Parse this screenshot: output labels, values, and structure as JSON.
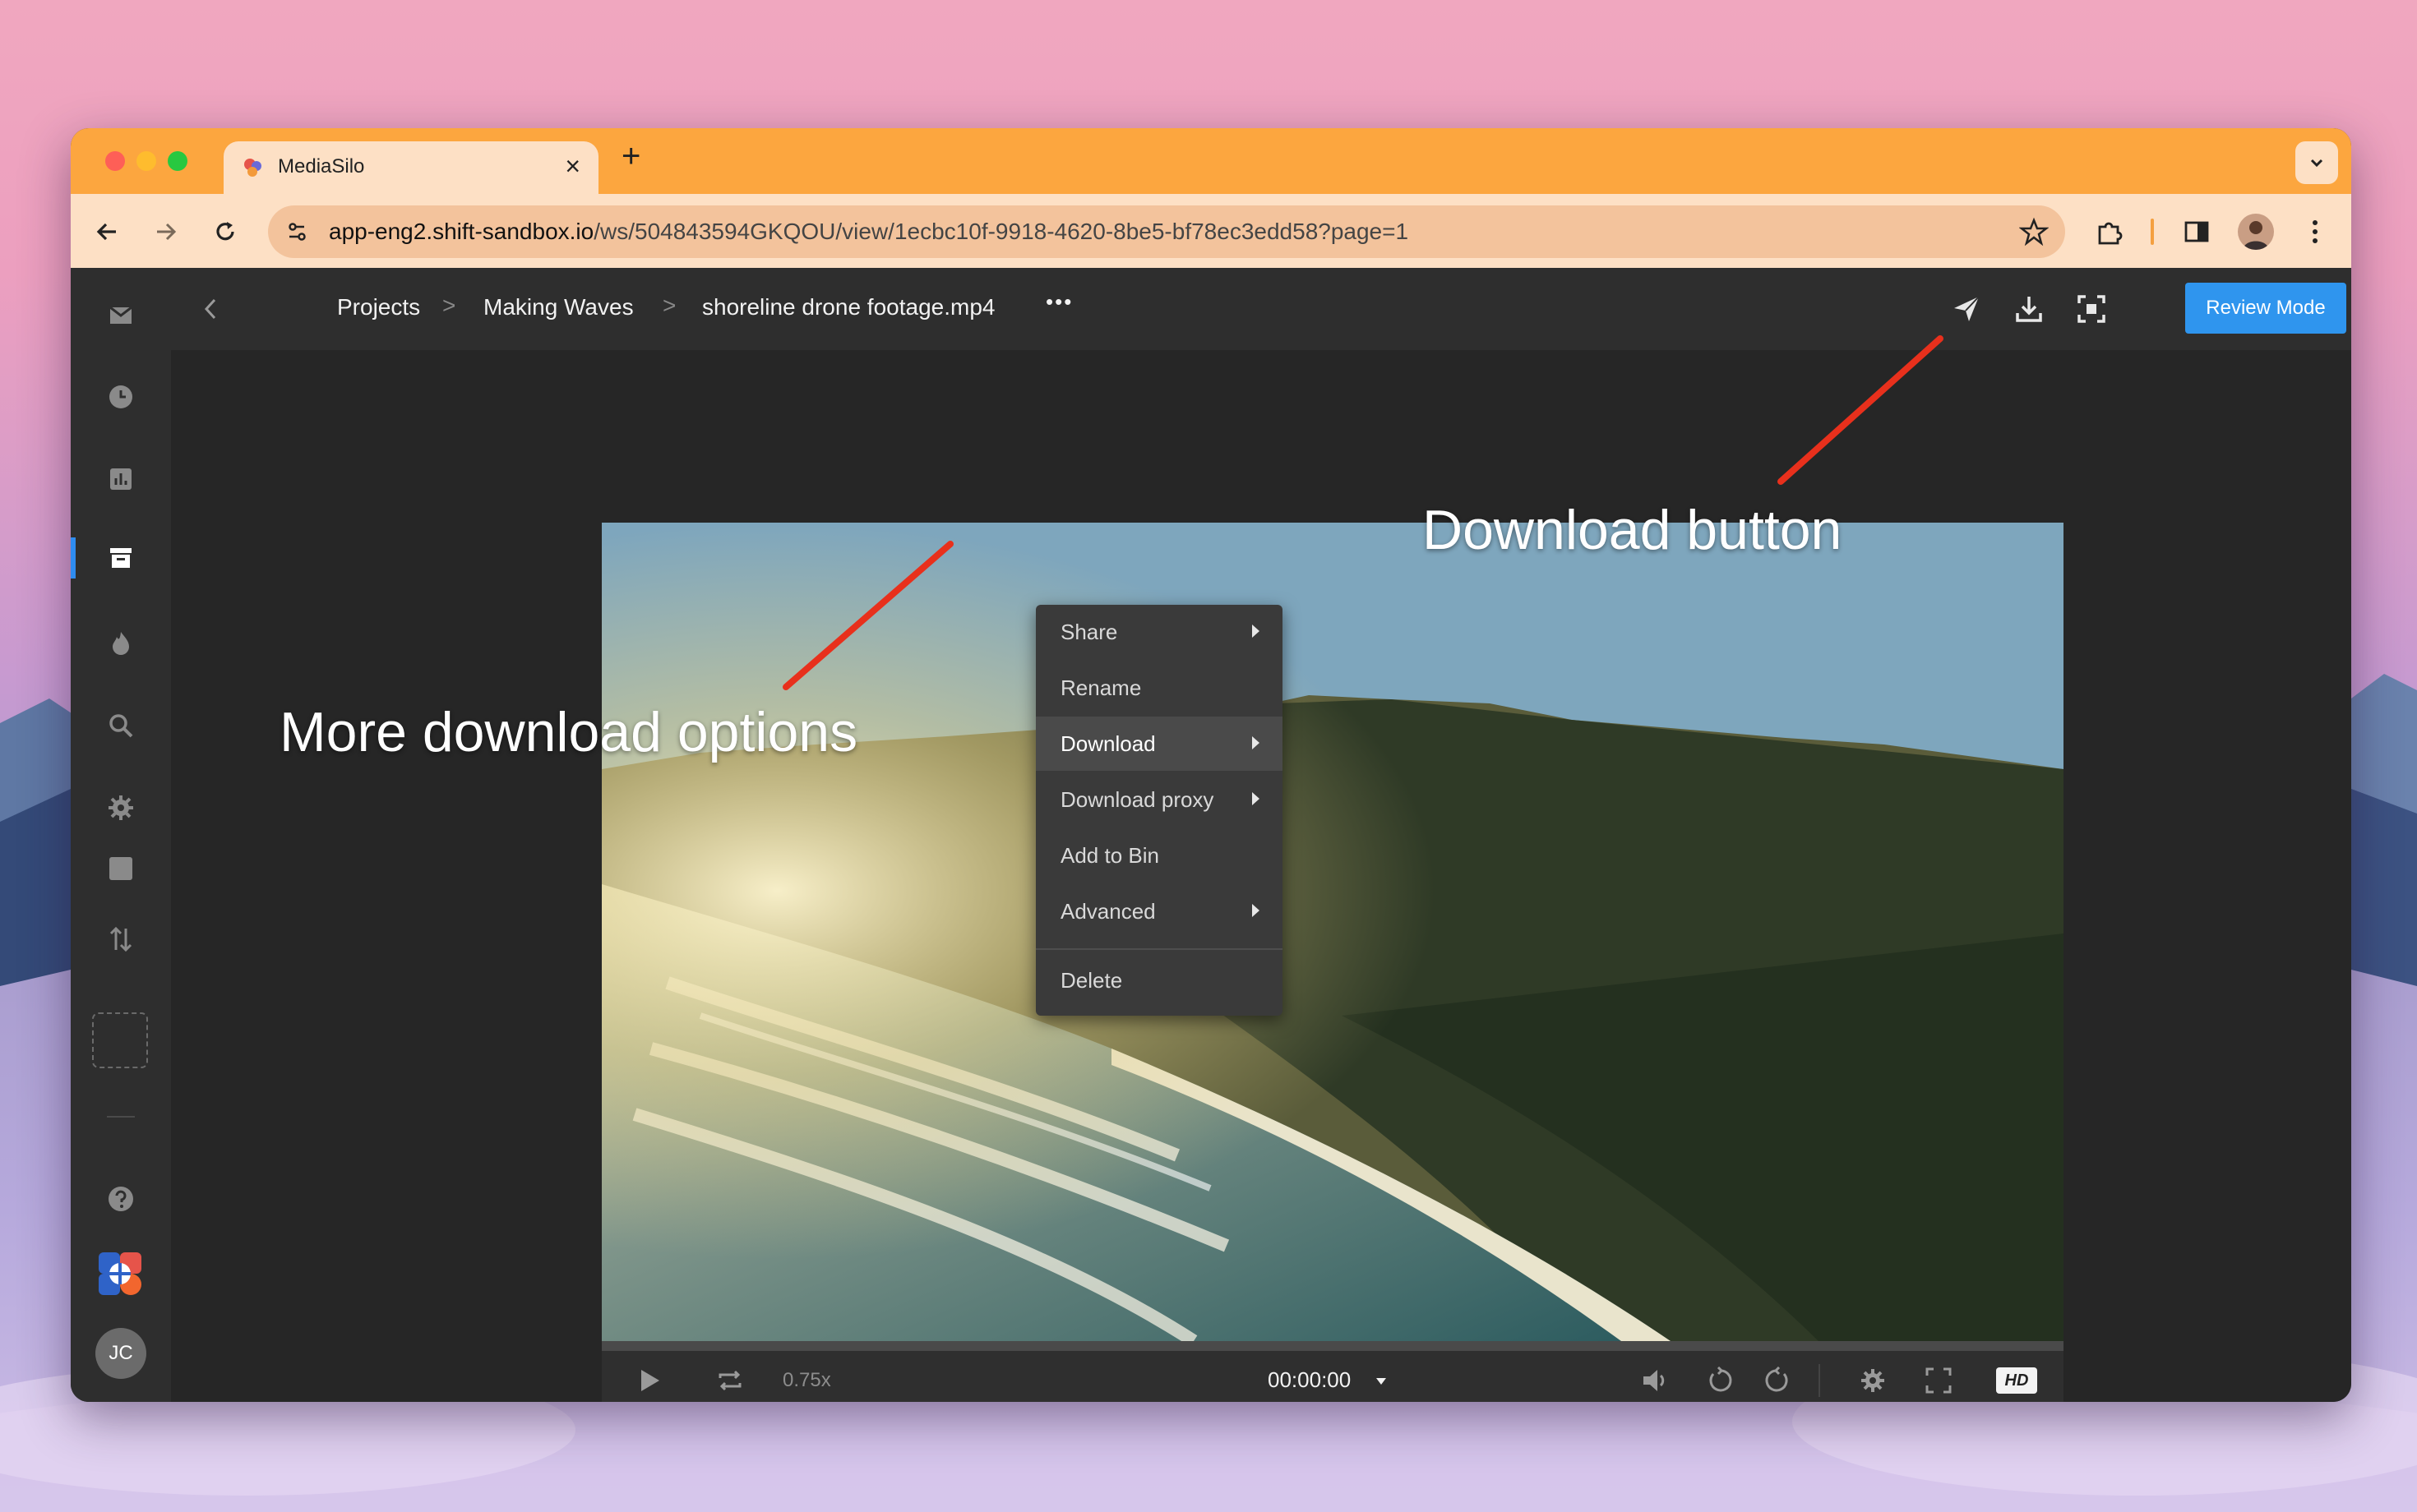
{
  "browser": {
    "tab_title": "MediaSilo",
    "tab_close": "×",
    "new_tab": "+",
    "url_host": "app-eng2.shift-sandbox.io",
    "url_path": "/ws/504843594GKQOU/view/1ecbc10f-9918-4620-8be5-bf78ec3edd58?page=1"
  },
  "header": {
    "breadcrumb": [
      "Projects",
      "Making Waves",
      "shoreline drone footage.mp4"
    ],
    "breadcrumb_sep": ">",
    "more": "•••",
    "review_mode": "Review Mode"
  },
  "context_menu": {
    "items": [
      "Share",
      "Rename",
      "Download",
      "Download proxy",
      "Add to Bin",
      "Advanced",
      "Delete"
    ],
    "highlighted": "Download"
  },
  "player": {
    "speed": "0.75x",
    "timecode": "00:00:00",
    "quality": "HD"
  },
  "user": {
    "initials": "JC"
  },
  "annotations": {
    "more_options": "More download options",
    "download_button": "Download button"
  },
  "colors": {
    "accent": "#2f95ee",
    "tabbar": "#fca63f",
    "annotation_arrow": "#e8301c"
  }
}
